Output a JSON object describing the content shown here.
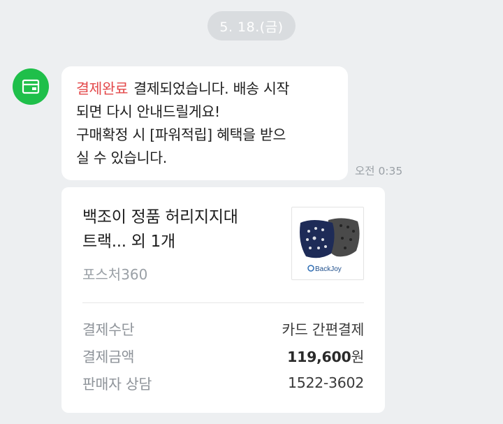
{
  "date_divider": "5. 18.(금)",
  "message": {
    "tag": "결제완료",
    "line1": "결제되었습니다. 배송 시작",
    "line2": "되면 다시 안내드릴게요!",
    "line3": "구매확정 시 [파워적립] 혜택을 받으",
    "line4": "실 수 있습니다.",
    "time": "오전 0:35"
  },
  "order_card": {
    "product_line1": "백조이 정품 허리지지대",
    "product_line2": "트랙... 외 1개",
    "store": "포스처360",
    "thumbnail_brand": "BackJoy",
    "details": [
      {
        "label": "결제수단",
        "value": "카드 간편결제"
      },
      {
        "label": "결제금액",
        "amount": "119,600",
        "unit": "원"
      },
      {
        "label": "판매자 상담",
        "value": "1522-3602"
      }
    ]
  },
  "colors": {
    "accent": "#e3484a",
    "avatar": "#1fbf4a",
    "background": "#edeff1"
  }
}
